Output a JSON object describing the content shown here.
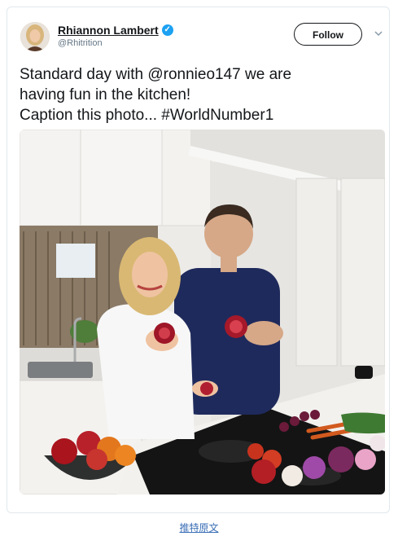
{
  "tweet": {
    "author_name": "Rhiannon Lambert",
    "author_handle": "@Rhitrition",
    "follow_label": "Follow",
    "text_lines": [
      "Standard day with @ronnieo147 we are",
      "having fun in the kitchen!",
      "Caption this photo... #WorldNumber1"
    ],
    "verified": true
  },
  "footer": {
    "link_label": "推特原文"
  },
  "icons": {
    "verified": "verified-badge-icon",
    "menu": "chevron-down-icon"
  },
  "colors": {
    "verified_blue": "#1da1f2",
    "text": "#14171a",
    "handle": "#657786",
    "link": "#3b6fb6"
  }
}
